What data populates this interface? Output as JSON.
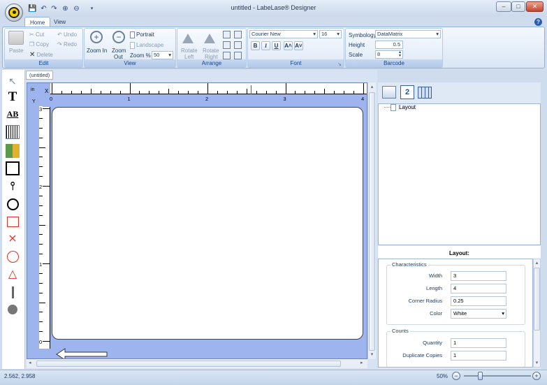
{
  "window": {
    "title": "untitled - LabeLase® Designer",
    "min": "–",
    "max": "□",
    "close": "✕"
  },
  "qat": {
    "icons": [
      "save-icon",
      "undo-icon",
      "redo-icon",
      "zoom-in-icon",
      "zoom-out-icon",
      "customize-icon"
    ]
  },
  "tabs": {
    "home": "Home",
    "view": "View",
    "help": "?"
  },
  "ribbon": {
    "edit": {
      "label": "Edit",
      "paste": "Paste",
      "cut": "Cut",
      "copy": "Copy",
      "delete": "Delete",
      "undo": "Undo",
      "redo": "Redo"
    },
    "view": {
      "label": "View",
      "zoom_in": "Zoom In",
      "zoom_out_1": "Zoom",
      "zoom_out_2": "Out",
      "portrait": "Portrait",
      "landscape": "Landscape",
      "zoom_pct_label": "Zoom %",
      "zoom_pct_value": "50"
    },
    "arrange": {
      "label": "Arrange",
      "rotate_left_1": "Rotate",
      "rotate_left_2": "Left",
      "rotate_right_1": "Rotate",
      "rotate_right_2": "Right"
    },
    "font": {
      "label": "Font",
      "family": "Courier New",
      "size": "16",
      "bold": "B",
      "italic": "I",
      "underline": "U",
      "grow": "A˄",
      "shrink": "A˅"
    },
    "barcode": {
      "label": "Barcode",
      "symbology_label": "Symbology",
      "symbology_value": "DataMatrix",
      "height_label": "Height",
      "height_value": "0.5",
      "scale_label": "Scale",
      "scale_value": "8"
    }
  },
  "document": {
    "tab": "(untitled)",
    "ruler_unit": "in",
    "x_axis": "X",
    "y_axis": "Y",
    "h_numbers": [
      "0",
      "1",
      "2",
      "3",
      "4"
    ],
    "v_numbers": [
      "3",
      "2",
      "1",
      "0"
    ]
  },
  "tree": {
    "root": "Layout"
  },
  "props": {
    "header": "Layout:",
    "characteristics": {
      "label": "Characteristics",
      "width_label": "Width",
      "width_value": "3",
      "length_label": "Length",
      "length_value": "4",
      "radius_label": "Corner Radius",
      "radius_value": "0.25",
      "color_label": "Color",
      "color_value": "White"
    },
    "counts": {
      "label": "Counts",
      "quantity_label": "Quantity",
      "quantity_value": "1",
      "dup_label": "Duplicate Copies",
      "dup_value": "1"
    }
  },
  "status": {
    "coords": "2.562, 2.958",
    "zoom": "50%",
    "zoom_out": "−",
    "zoom_in": "+"
  }
}
